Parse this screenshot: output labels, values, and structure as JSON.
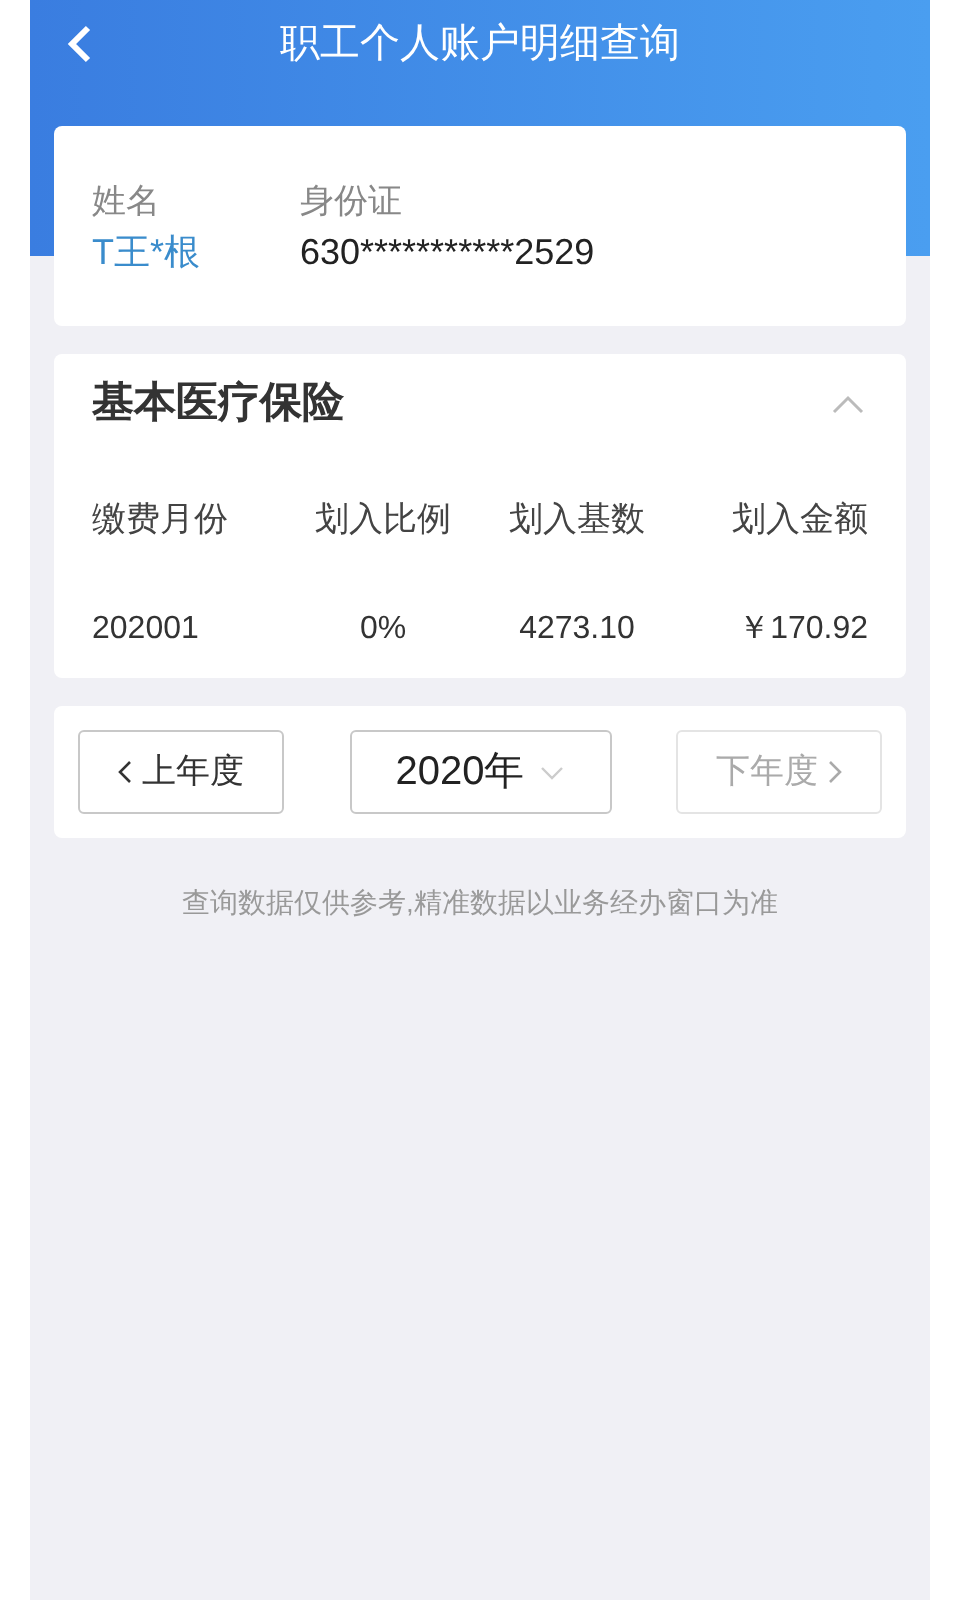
{
  "header": {
    "title": "职工个人账户明细查询"
  },
  "person": {
    "name_label": "姓名",
    "name": "T王*根",
    "id_label": "身份证",
    "id": "630***********2529"
  },
  "section": {
    "title": "基本医疗保险",
    "expanded": true,
    "columns": [
      "缴费月份",
      "划入比例",
      "划入基数",
      "划入金额"
    ],
    "rows": [
      [
        "202001",
        "0%",
        "4273.10",
        "￥170.92"
      ]
    ]
  },
  "year_bar": {
    "prev": {
      "label": "上年度",
      "disabled": false
    },
    "year": "2020年",
    "next": {
      "label": "下年度",
      "disabled": true
    }
  },
  "note": "查询数据仅供参考,精准数据以业务经办窗口为准"
}
